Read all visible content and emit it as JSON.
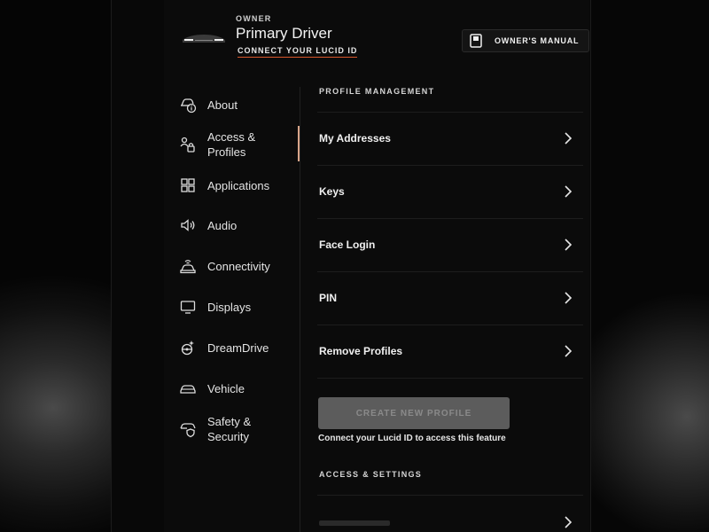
{
  "header": {
    "owner_label": "OWNER",
    "owner_name": "Primary Driver",
    "connect_link": "CONNECT YOUR LUCID ID",
    "manual_button": "OWNER'S MANUAL",
    "manual_icon": "book-icon"
  },
  "sidebar": {
    "active_index": 1,
    "items": [
      {
        "label": "About",
        "icon": "car-info-icon"
      },
      {
        "label": "Access &\nProfiles",
        "icon": "profiles-lock-icon"
      },
      {
        "label": "Applications",
        "icon": "grid-icon"
      },
      {
        "label": "Audio",
        "icon": "speaker-icon"
      },
      {
        "label": "Connectivity",
        "icon": "car-signal-icon"
      },
      {
        "label": "Displays",
        "icon": "monitor-icon"
      },
      {
        "label": "DreamDrive",
        "icon": "steering-sparkle-icon"
      },
      {
        "label": "Vehicle",
        "icon": "car-icon"
      },
      {
        "label": "Safety &\nSecurity",
        "icon": "car-shield-icon"
      }
    ]
  },
  "main": {
    "profile_section_title": "PROFILE MANAGEMENT",
    "rows": [
      {
        "label": "My Addresses"
      },
      {
        "label": "Keys"
      },
      {
        "label": "Face Login"
      },
      {
        "label": "PIN"
      },
      {
        "label": "Remove Profiles"
      }
    ],
    "create_button": "CREATE NEW PROFILE",
    "create_note": "Connect your Lucid ID to access this feature",
    "access_section_title": "ACCESS & SETTINGS"
  },
  "colors": {
    "accent": "#d8552a",
    "active_indicator": "#d8a58a",
    "disabled_button": "#5c5c5c"
  }
}
